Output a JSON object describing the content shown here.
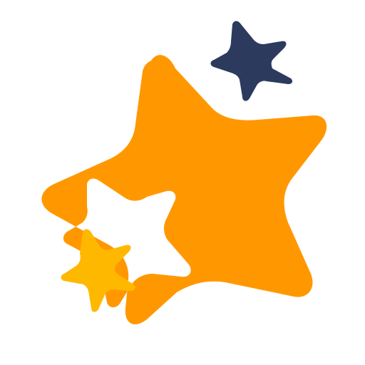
{
  "logo": {
    "icon": "stars-logo-icon",
    "colors": {
      "background": "#ffffff",
      "big_star": "#FF9800",
      "navy_star": "#2C3A5E",
      "small_star": "#FFB800"
    }
  }
}
